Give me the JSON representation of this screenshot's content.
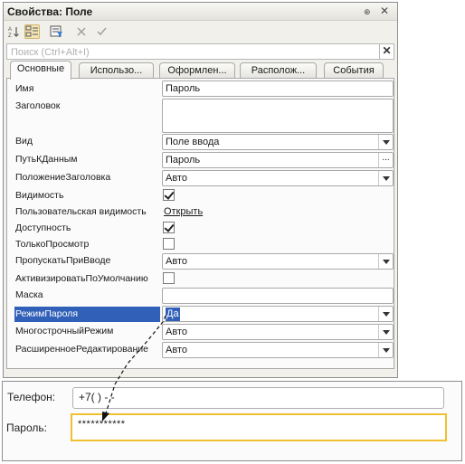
{
  "window": {
    "title": "Свойства: Поле",
    "pin_glyph": "⊕",
    "close_glyph": "✕"
  },
  "search": {
    "placeholder": "Поиск (Ctrl+Alt+I)",
    "clear_glyph": "✕"
  },
  "tabs": [
    {
      "label": "Основные",
      "active": true
    },
    {
      "label": "Использо..."
    },
    {
      "label": "Оформлен..."
    },
    {
      "label": "Располож..."
    },
    {
      "label": "События"
    }
  ],
  "properties": {
    "name": {
      "label": "Имя",
      "value": "Пароль"
    },
    "header": {
      "label": "Заголовок",
      "value": ""
    },
    "view": {
      "label": "Вид",
      "value": "Поле ввода"
    },
    "data_path": {
      "label": "ПутьКДанным",
      "value": "Пароль",
      "button": "..."
    },
    "title_location": {
      "label": "ПоложениеЗаголовка",
      "value": "Авто"
    },
    "visible": {
      "label": "Видимость",
      "checked": true
    },
    "user_visibility": {
      "label": "Пользовательская видимость",
      "link": "Открыть"
    },
    "enabled": {
      "label": "Доступность",
      "checked": true
    },
    "read_only": {
      "label": "ТолькоПросмотр",
      "checked": false
    },
    "skip_on_input": {
      "label": "ПропускатьПриВводе",
      "value": "Авто"
    },
    "default_control": {
      "label": "АктивизироватьПоУмолчанию",
      "checked": false
    },
    "mask": {
      "label": "Маска",
      "value": ""
    },
    "password_mode": {
      "label": "РежимПароля",
      "value": "Да"
    },
    "multiline": {
      "label": "МногострочныйРежим",
      "value": "Авто"
    },
    "extended_edit": {
      "label": "РасширенноеРедактирование",
      "value": "Авто"
    }
  },
  "preview": {
    "phone": {
      "label": "Телефон:",
      "value": "+7(   )   -   -"
    },
    "password": {
      "label": "Пароль:",
      "value": "***********"
    }
  },
  "colors": {
    "selection": "#3160b8",
    "active_field_border": "#f0c030"
  }
}
